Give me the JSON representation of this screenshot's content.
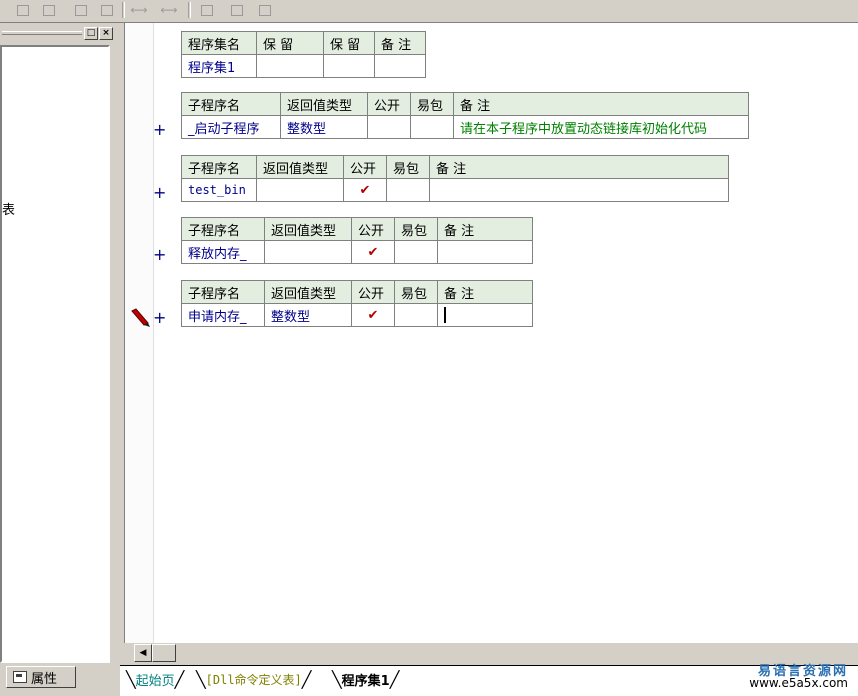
{
  "toolbar": {
    "icons": [
      "align-left-icon",
      "align-center-icon",
      "align-top-icon",
      "align-middle-icon",
      "distribute-h-icon",
      "distribute-v-icon",
      "same-width-icon",
      "same-height-icon",
      "same-size-icon"
    ]
  },
  "left_panel": {
    "fragment": "表",
    "btn_restore": "□",
    "btn_close": "×",
    "properties_tab": "属性"
  },
  "assembly_table": {
    "headers": [
      "程序集名",
      "保 留",
      "保 留",
      "备 注"
    ],
    "row": [
      "程序集1",
      "",
      "",
      ""
    ]
  },
  "subs": [
    {
      "headers": [
        "子程序名",
        "返回值类型",
        "公开",
        "易包",
        "备 注"
      ],
      "name": "_启动子程序",
      "return_type": "整数型",
      "public": "",
      "easy": "",
      "note": "请在本子程序中放置动态链接库初始化代码"
    },
    {
      "headers": [
        "子程序名",
        "返回值类型",
        "公开",
        "易包",
        "备 注"
      ],
      "name": "test_bin",
      "return_type": "",
      "public": "✔",
      "easy": "",
      "note": ""
    },
    {
      "headers": [
        "子程序名",
        "返回值类型",
        "公开",
        "易包",
        "备 注"
      ],
      "name": "释放内存_",
      "return_type": "",
      "public": "✔",
      "easy": "",
      "note": ""
    },
    {
      "headers": [
        "子程序名",
        "返回值类型",
        "公开",
        "易包",
        "备 注"
      ],
      "name": "申请内存_",
      "return_type": "整数型",
      "public": "✔",
      "easy": "",
      "note": ""
    }
  ],
  "expand_symbol": "+",
  "tabs": {
    "start": "起始页",
    "dll": "[Dll命令定义表]",
    "active": "程序集1"
  },
  "watermark": {
    "line1": "易语言资源网",
    "line2": "www.e5a5x.com"
  }
}
